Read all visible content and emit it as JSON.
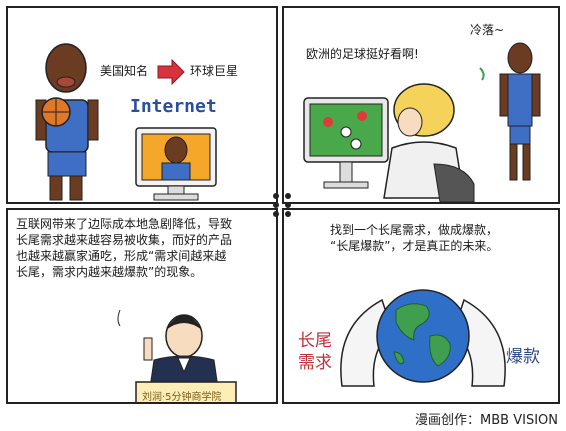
{
  "panel1": {
    "caption_left": "美国知名",
    "caption_right": "环球巨星",
    "screen_word": "Internet"
  },
  "panel2": {
    "speech": "欧洲的足球挺好看啊!",
    "aside": "冷落~"
  },
  "panel3": {
    "lines": [
      "互联网带来了边际成本地急剧降低，导致",
      "长尾需求越来越容易被收集，而好的产品",
      "也越来越赢家通吃，形成“需求间越来越",
      "长尾，需求内越来越爆款”的现象。"
    ],
    "podium": "刘润·5分钟商学院"
  },
  "panel4": {
    "lines": [
      "找到一个长尾需求，做成爆款，",
      "“长尾爆款”，才是真正的未来。"
    ],
    "left_sign": [
      "长尾",
      "需求"
    ],
    "right_sign": "爆款"
  },
  "credit": "漫画创作：MBB VISION",
  "colors": {
    "jersey": "#3f6fc4",
    "skin": "#6b3b22",
    "ball": "#e07828",
    "arrow": "#d8323c",
    "hair": "#f5d35a",
    "field": "#49a84a",
    "ocean": "#2f6fc7",
    "land": "#3f9f4f",
    "sign_red": "#c0303a"
  }
}
